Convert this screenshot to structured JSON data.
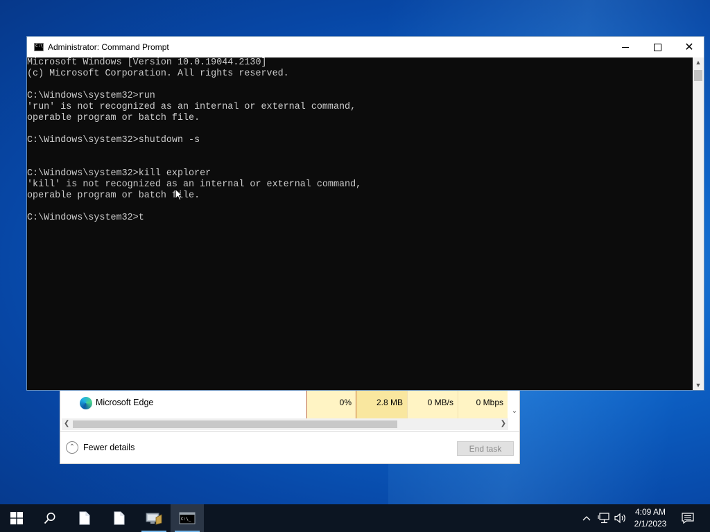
{
  "cmd_window": {
    "title": "Administrator: Command Prompt",
    "console_lines": [
      "Microsoft Windows [Version 10.0.19044.2130]",
      "(c) Microsoft Corporation. All rights reserved.",
      "",
      "C:\\Windows\\system32>run",
      "'run' is not recognized as an internal or external command,",
      "operable program or batch file.",
      "",
      "C:\\Windows\\system32>shutdown -s",
      "",
      "",
      "C:\\Windows\\system32>kill explorer",
      "'kill' is not recognized as an internal or external command,",
      "operable program or batch file.",
      "",
      "C:\\Windows\\system32>t"
    ]
  },
  "task_manager": {
    "process": {
      "name": "Microsoft Edge",
      "cpu": "0%",
      "memory": "2.8 MB",
      "disk": "0 MB/s",
      "network": "0 Mbps"
    },
    "fewer_details_label": "Fewer details",
    "end_task_label": "End task"
  },
  "taskbar": {
    "items": [
      "start",
      "search",
      "file-1",
      "file-2",
      "server-manager",
      "command-prompt"
    ],
    "active_item": "command-prompt",
    "clock_time": "4:09 AM",
    "clock_date": "2/1/2023"
  },
  "colors": {
    "console_bg": "#0c0c0c",
    "console_text": "#cccccc",
    "taskbar_bg": "#0c1522",
    "desktop_blue": "#0d63c8"
  }
}
